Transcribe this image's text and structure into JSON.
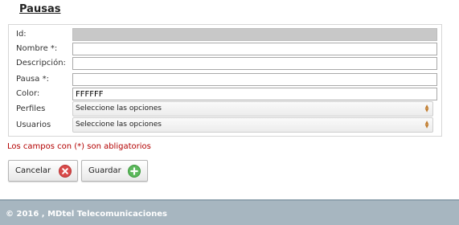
{
  "page": {
    "title": "Pausas"
  },
  "form": {
    "fields": [
      {
        "label": "Id:",
        "value": "",
        "disabled": true
      },
      {
        "label": "Nombre *:",
        "value": ""
      },
      {
        "label": "Descripción:",
        "value": ""
      },
      {
        "label": "Pausa *:",
        "value": ""
      },
      {
        "label": "Color:",
        "value": "FFFFFF"
      }
    ],
    "selects": [
      {
        "label": "Perfiles",
        "selected": "Seleccione las opciones"
      },
      {
        "label": "Usuarios",
        "selected": "Seleccione las opciones"
      }
    ],
    "required_note": "Los campos con (*) son abligatorios"
  },
  "buttons": {
    "cancel_label": "Cancelar",
    "save_label": "Guardar"
  },
  "footer": {
    "text": "© 2016 , MDtel Telecomunicaciones"
  },
  "colors": {
    "error_text": "#b30000",
    "footer_bg": "#a7b6c0",
    "cancel_icon": "#d94a4a",
    "save_icon": "#5cb85c"
  },
  "icons": {
    "cancel": "close-circle-icon",
    "save": "plus-circle-icon"
  }
}
